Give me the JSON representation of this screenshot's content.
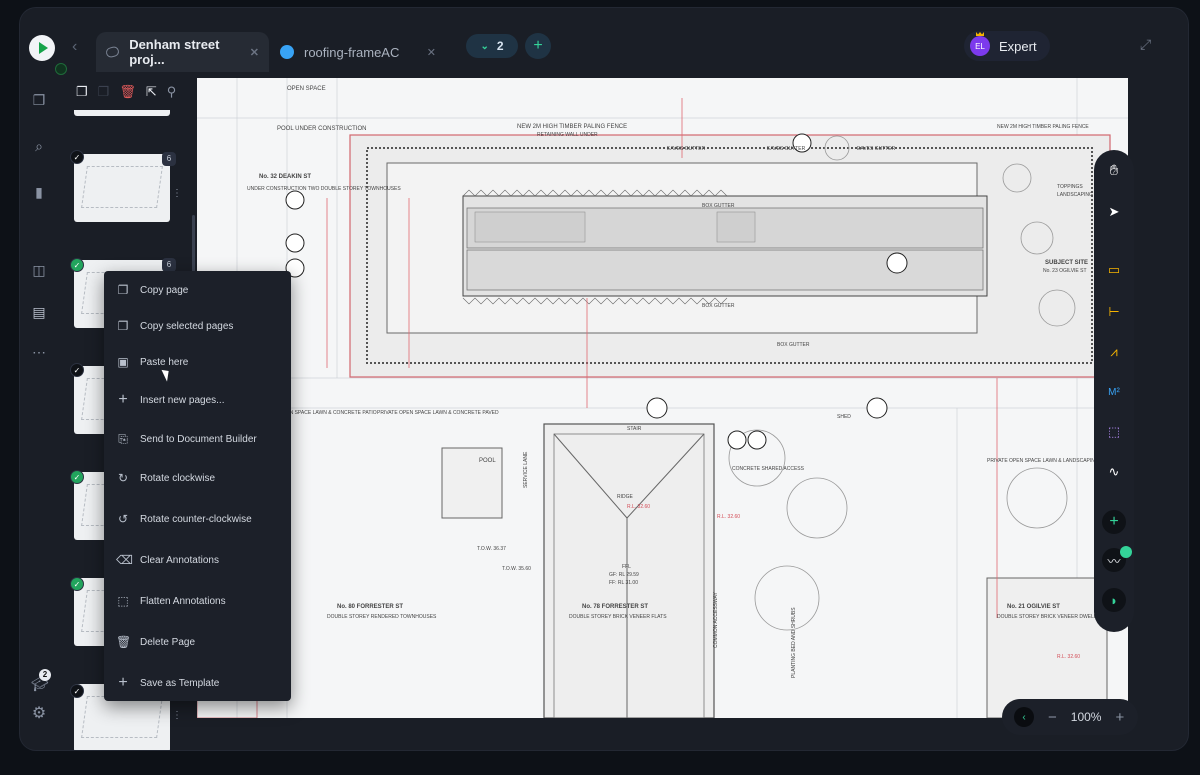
{
  "tabs": [
    {
      "label": "Denham street proj..."
    },
    {
      "label": "roofing-frameAC"
    }
  ],
  "tab_count": "2",
  "user": {
    "initials": "EL",
    "plan": "Expert"
  },
  "thumbnails": {
    "page_badges": [
      "6",
      "6"
    ]
  },
  "notifications": {
    "count": "2"
  },
  "context_menu": {
    "items": [
      {
        "label": "Copy page",
        "icon": "copy-icon"
      },
      {
        "label": "Copy selected pages",
        "icon": "copy-multiple-icon"
      },
      {
        "label": "Paste here",
        "icon": "clipboard-icon"
      },
      {
        "label": "Insert new pages...",
        "icon": "plus-icon"
      },
      {
        "label": "Send to Document Builder",
        "icon": "document-builder-icon"
      },
      {
        "label": "Rotate clockwise",
        "icon": "rotate-clockwise-icon"
      },
      {
        "label": "Rotate counter-clockwise",
        "icon": "rotate-counter-clockwise-icon"
      },
      {
        "label": "Clear Annotations",
        "icon": "clear-annotations-icon"
      },
      {
        "label": "Flatten Annotations",
        "icon": "flatten-icon"
      },
      {
        "label": "Delete Page",
        "icon": "trash-icon"
      },
      {
        "label": "Save as Template",
        "icon": "plus-icon"
      }
    ]
  },
  "drawing": {
    "labels": {
      "open_space": "OPEN SPACE",
      "pool_under_construction": "POOL UNDER CONSTRUCTION",
      "deakin": "No. 32 DEAKIN ST",
      "deakin_desc": "UNDER CONSTRUCTION TWO DOUBLE STOREY TOWNHOUSES",
      "high_fence_top": "NEW 2M HIGH TIMBER PALING FENCE",
      "retaining_wall": "RETAINING WALL UNDER",
      "eaves_gutter_1": "EAVES GUTTER",
      "eaves_gutter_2": "EAVES GUTTER",
      "eaves_gutter_3": "EAVES GUTTER",
      "box_gutter_1": "BOX GUTTER",
      "box_gutter_2": "BOX GUTTER",
      "box_gutter_3": "BOX GUTTER",
      "high_fence_right": "NEW 2M HIGH TIMBER PALING FENCE",
      "subject_site": "SUBJECT SITE",
      "subject_site_address": "No. 23 OGILVIE ST",
      "toppings": "TOPPINGS",
      "landscaping": "LANDSCAPING",
      "private_open_space_left": "PRIVATE OPEN SPACE LAWN & CONCRETE PATIO",
      "private_open_space_mid": "PRIVATE OPEN SPACE LAWN & CONCRETE PAVED",
      "private_open_space_right": "PRIVATE OPEN SPACE LAWN & LANDSCAPING",
      "pool": "POOL",
      "stair": "STAIR",
      "shed": "SHED",
      "concrete_shared": "CONCRETE SHARED ACCESS",
      "planting": "PLANTING BED AND SHRUBS",
      "service_lane": "SERVICE LANE",
      "common_access": "COMMON ACCESSWAY",
      "forrester_80": "No. 80 FORRESTER ST",
      "forrester_80_desc": "DOUBLE STOREY RENDERED TOWNHOUSES",
      "forrester_78": "No. 78 FORRESTER ST",
      "forrester_78_desc": "DOUBLE STOREY BRICK VENEER FLATS",
      "ogilvie_21": "No. 21 OGILVIE ST",
      "ogilvie_21_desc": "DOUBLE STOREY BRICK VENEER DWELLING",
      "ridge": "RIDGE",
      "ffl": "FFL",
      "rl_1": "R.L. 32.60",
      "rl_2": "R.L. 32.60",
      "rl_3": "R.L. 32.60",
      "tow_1": "T.O.W. 36.37",
      "tow_2": "T.O.W. 35.60",
      "gf": "GF: RL 29.59",
      "ff": "FF: RL 31.00"
    }
  },
  "zoom": {
    "level": "100%"
  },
  "colors": {
    "accent": "#34d399",
    "brand": "#16a34a",
    "frame": "#1a1e26"
  }
}
